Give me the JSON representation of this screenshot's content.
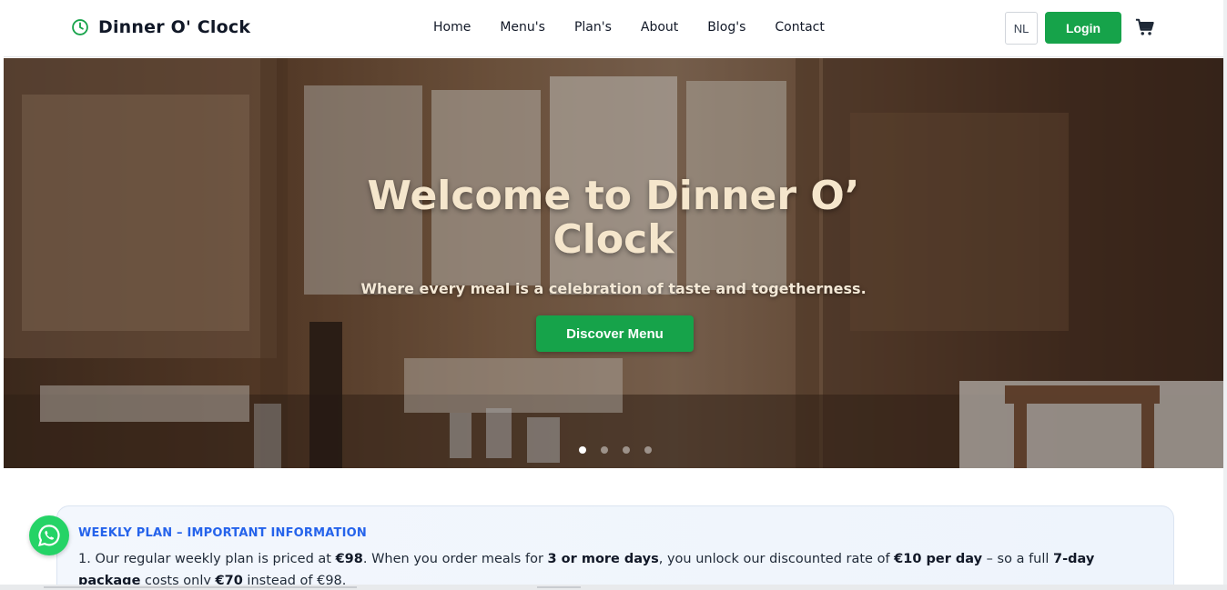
{
  "header": {
    "brand_name": "Dinner O' Clock",
    "brand_icon": "clock-icon",
    "nav": [
      "Home",
      "Menu's",
      "Plan's",
      "About",
      "Blog's",
      "Contact"
    ],
    "lang_label": "NL",
    "login_label": "Login",
    "cart_icon": "cart-icon"
  },
  "hero": {
    "title": "Welcome to Dinner O’ Clock",
    "subtitle": "Where every meal is a celebration of taste and togetherness.",
    "cta_label": "Discover Menu",
    "slides_total": 4,
    "active_slide": 1
  },
  "info": {
    "title": "WEEKLY PLAN – IMPORTANT INFORMATION",
    "p1_a": "1. Our regular weekly plan is priced at ",
    "p1_price": "€98",
    "p1_b": ". When you order meals for ",
    "p1_days": "3 or more days",
    "p1_c": ", you unlock our discounted rate of ",
    "p1_rate": "€10 per day",
    "p1_d": " – so a full ",
    "p1_pkg": "7-day package",
    "p1_e": " costs only ",
    "p1_total": "€70",
    "p1_f": " instead of €98."
  },
  "colors": {
    "brand_green": "#16a34a",
    "info_title_blue": "#2563eb",
    "hero_title": "#f5e6cc"
  },
  "floating": {
    "whatsapp_icon": "whatsapp-icon"
  }
}
